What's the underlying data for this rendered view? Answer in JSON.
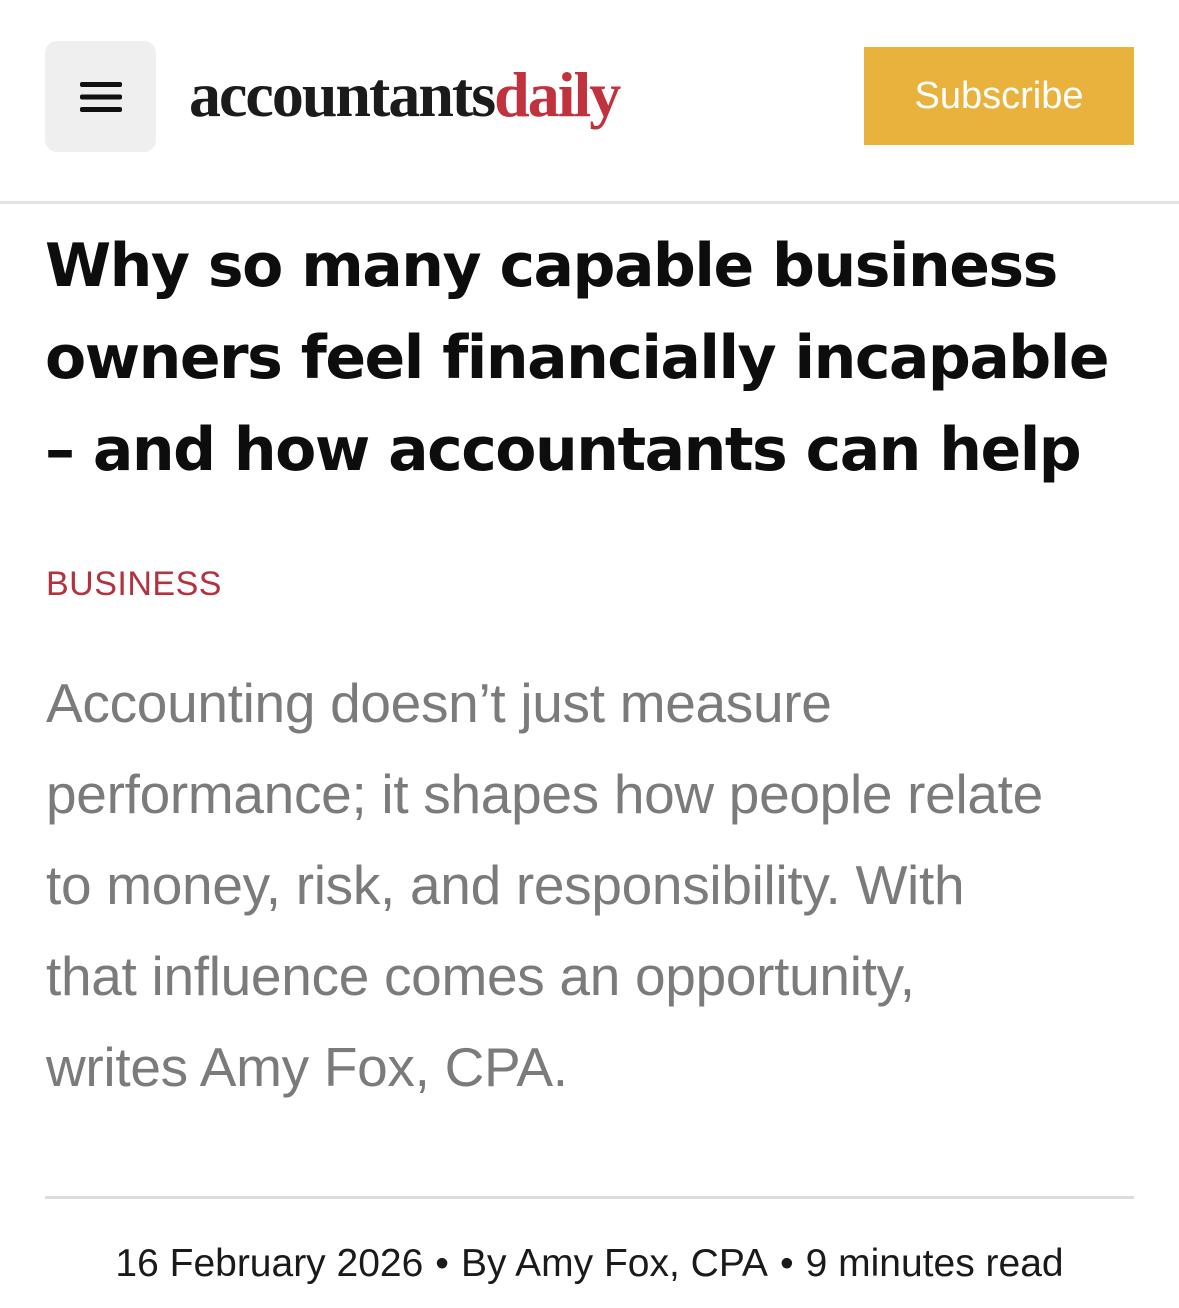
{
  "header": {
    "menu_icon": "hamburger-menu-icon",
    "logo_part_1": "accountants",
    "logo_part_2": "daily",
    "subscribe_label": "Subscribe"
  },
  "article": {
    "headline_lines": [
      "Why so many capable business",
      "owners feel financially incapable",
      "– and how accountants can help"
    ],
    "category": "BUSINESS",
    "standfirst_lines": [
      "Accounting doesn’t just measure",
      "performance; it shapes how people relate",
      "to money, risk, and responsibility. With",
      "that influence comes an opportunity,",
      "writes Amy Fox, CPA."
    ],
    "meta": {
      "date": "16 February 2026",
      "author": "By Amy Fox, CPA",
      "read_time": "9 minutes read",
      "separator": "•"
    }
  },
  "colors": {
    "logo_dark": "#1b1b1b",
    "logo_accent": "#c0323e",
    "subscribe_bg": "#e9b23c",
    "category": "#b2323d",
    "standfirst": "#7b7b7b"
  }
}
